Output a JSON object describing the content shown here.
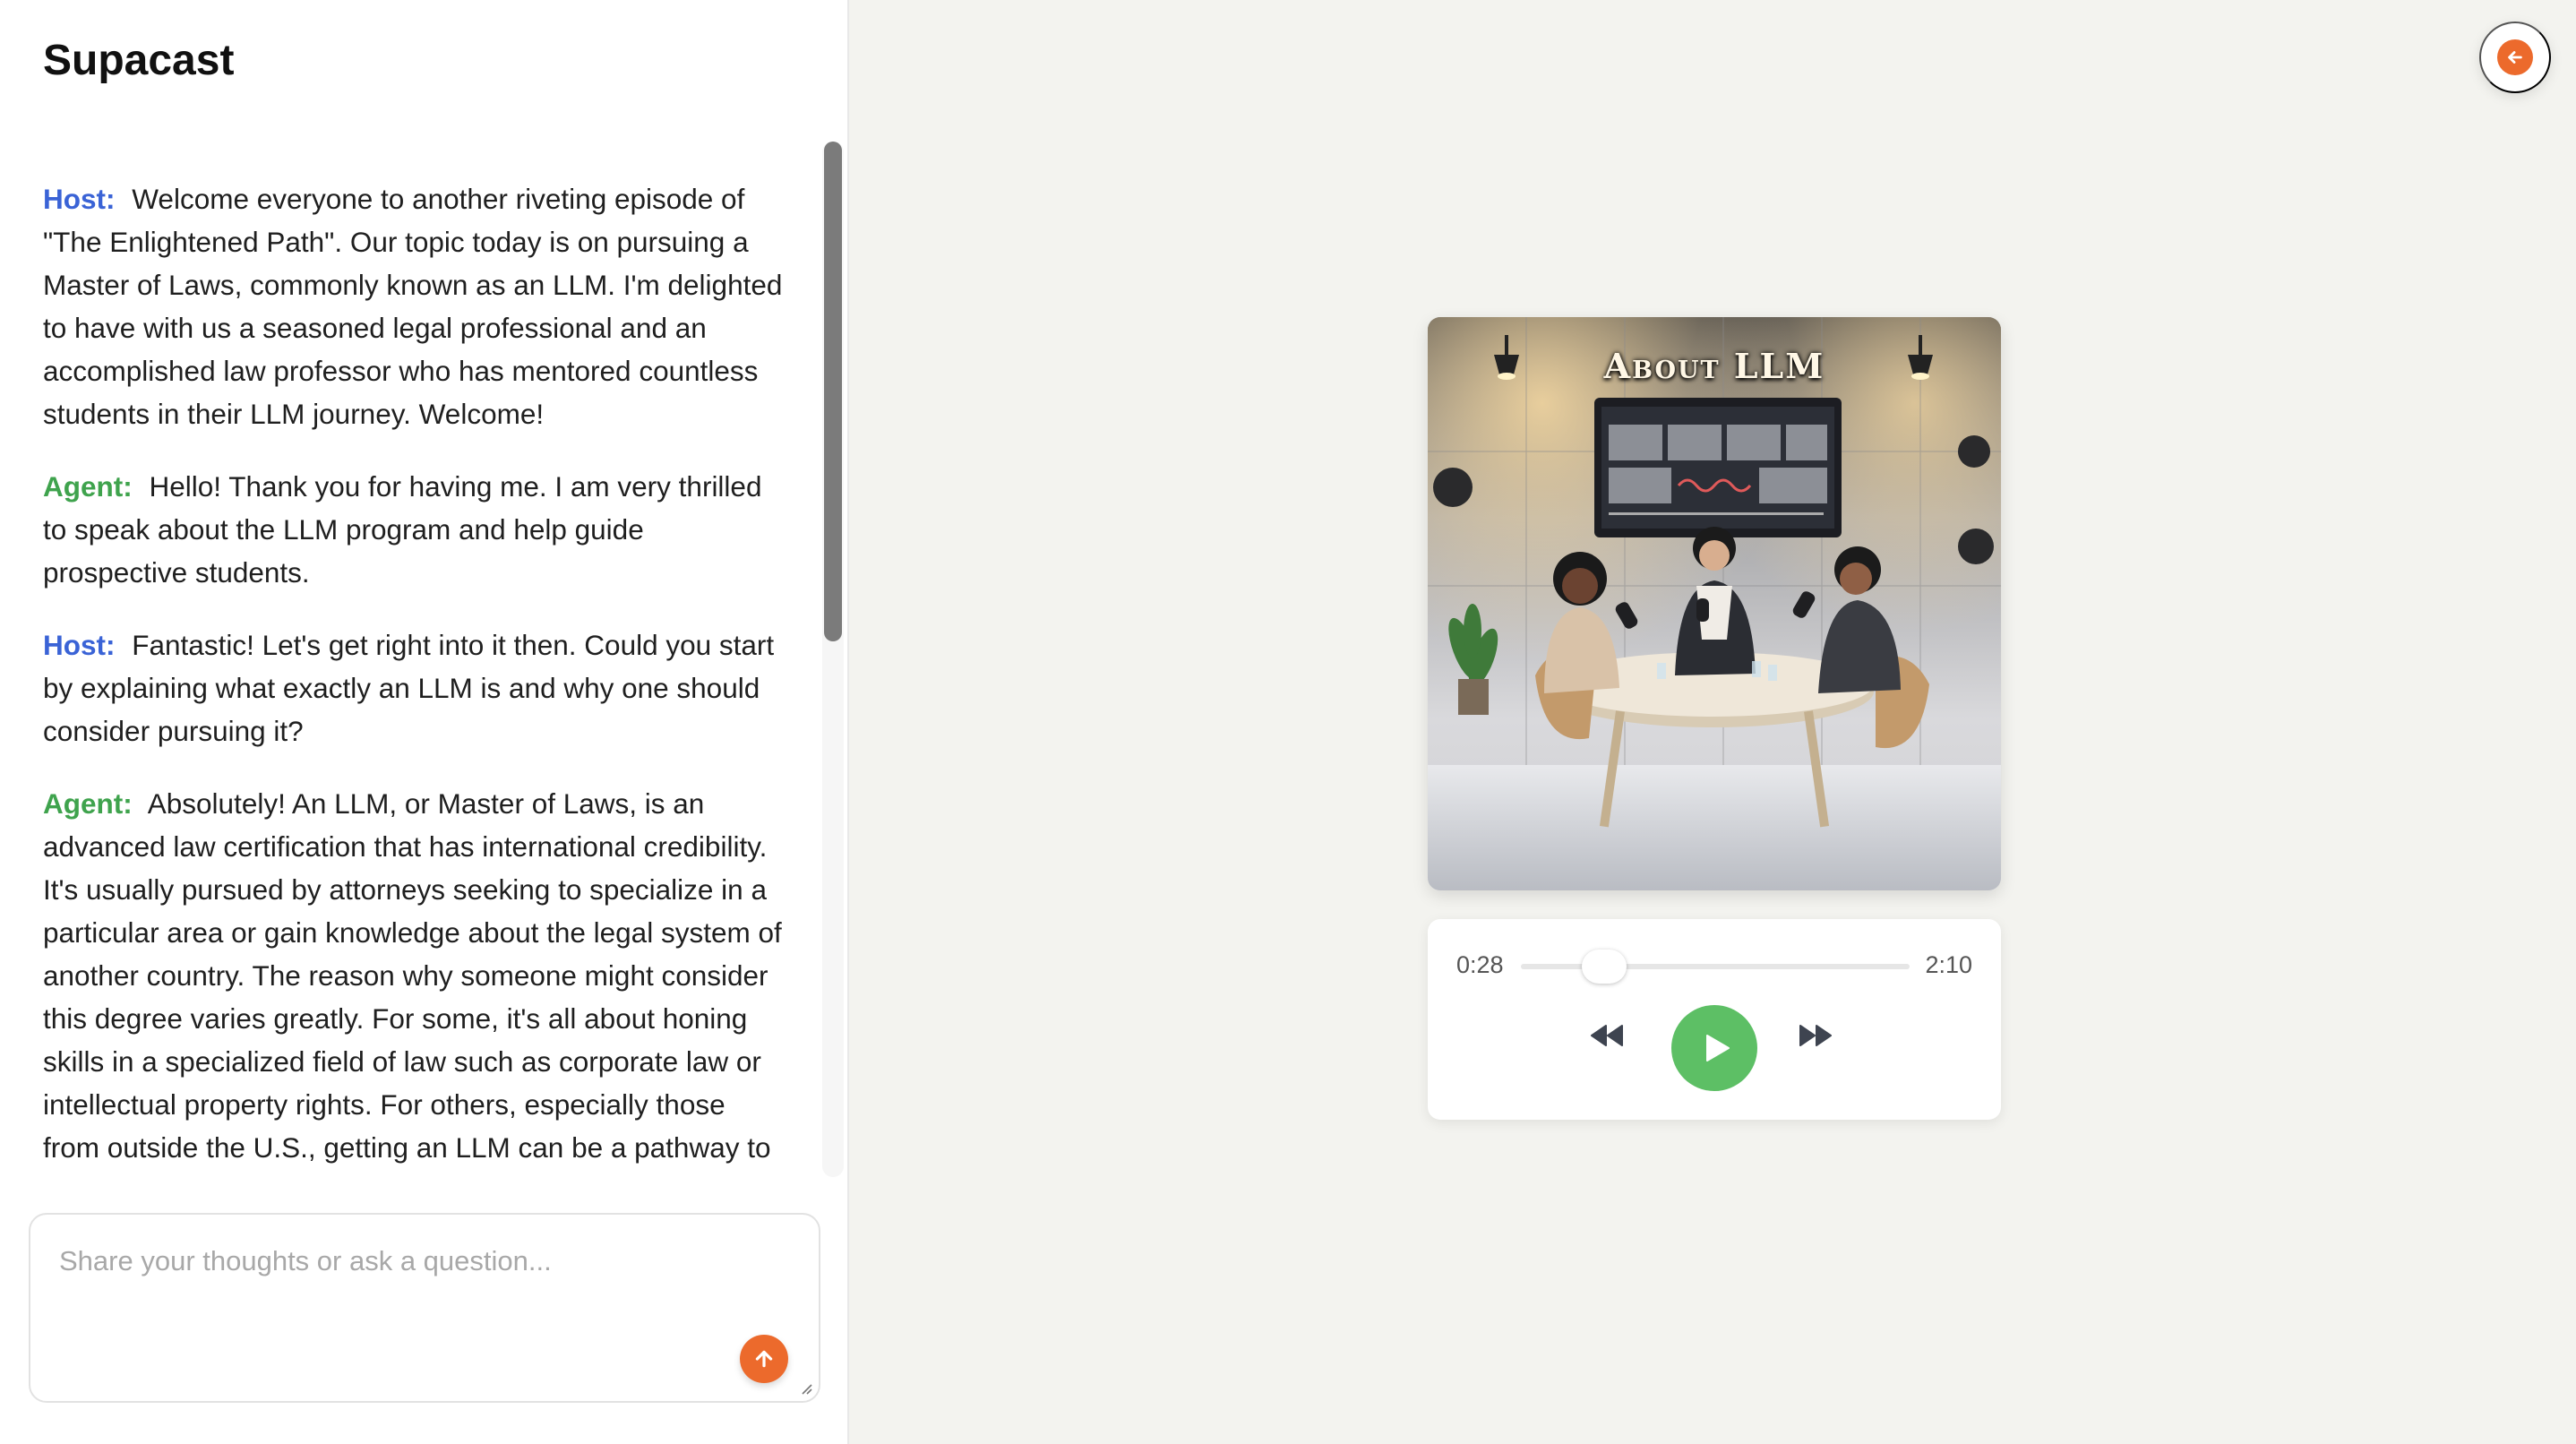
{
  "app": {
    "title": "Supacast"
  },
  "transcript": [
    {
      "speaker": "Host:",
      "role": "host",
      "text": "Welcome everyone to another riveting episode of \"The Enlightened Path\". Our topic today is on pursuing a Master of Laws, commonly known as an LLM. I'm delighted to have with us a seasoned legal professional and an accomplished law professor who has mentored countless students in their LLM journey. Welcome!"
    },
    {
      "speaker": "Agent:",
      "role": "agent",
      "text": "Hello! Thank you for having me. I am very thrilled to speak about the LLM program and help guide prospective students."
    },
    {
      "speaker": "Host:",
      "role": "host",
      "text": "Fantastic! Let's get right into it then. Could you start by explaining what exactly an LLM is and why one should consider pursuing it?"
    },
    {
      "speaker": "Agent:",
      "role": "agent",
      "text": "Absolutely! An LLM, or Master of Laws, is an advanced law certification that has international credibility. It's usually pursued by attorneys seeking to specialize in a particular area or gain knowledge about the legal system of another country. The reason why someone might consider this degree varies greatly. For some, it's all about honing skills in a specialized field of law such as corporate law or intellectual property rights. For others, especially those from outside the U.S., getting an LLM can be a pathway to understanding U.S. legal system better."
    }
  ],
  "composer": {
    "placeholder": "Share your thoughts or ask a question..."
  },
  "cover": {
    "title": "About LLM"
  },
  "player": {
    "current_time": "0:28",
    "duration": "2:10",
    "progress_fraction": 0.215
  },
  "colors": {
    "accent": "#ec6a2c",
    "host": "#3a63d6",
    "agent": "#3fa34d",
    "play": "#5dbf65"
  },
  "icons": {
    "back": "arrow-left-icon",
    "send": "arrow-up-icon",
    "play": "play-icon",
    "rewind": "rewind-icon",
    "forward": "fast-forward-icon"
  }
}
